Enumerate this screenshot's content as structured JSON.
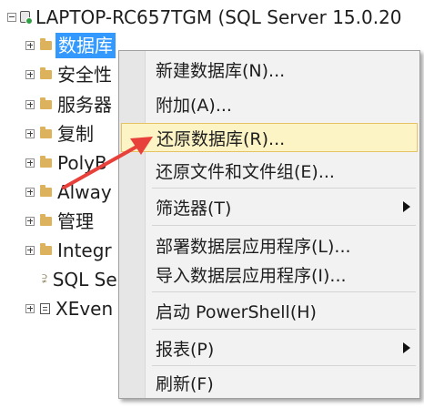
{
  "tree": {
    "server_label": "LAPTOP-RC657TGM (SQL Server 15.0.20",
    "items": [
      {
        "label": "数据库"
      },
      {
        "label": "安全性"
      },
      {
        "label": "服务器"
      },
      {
        "label": "复制"
      },
      {
        "label": "PolyB"
      },
      {
        "label": "Alway"
      },
      {
        "label": "管理"
      },
      {
        "label": "Integr"
      },
      {
        "label": "SQL Se"
      },
      {
        "label": "XEven"
      }
    ]
  },
  "context_menu": {
    "items": [
      {
        "label": "新建数据库(N)..."
      },
      {
        "label": "附加(A)..."
      },
      {
        "label": "还原数据库(R)..."
      },
      {
        "label": "还原文件和文件组(E)..."
      },
      {
        "label": "筛选器(T)"
      },
      {
        "label": "部署数据层应用程序(L)..."
      },
      {
        "label": "导入数据层应用程序(I)..."
      },
      {
        "label": "启动 PowerShell(H)"
      },
      {
        "label": "报表(P)"
      },
      {
        "label": "刷新(F)"
      }
    ],
    "highlighted": "还原数据库(R)..."
  },
  "colors": {
    "selection": "#3399ff",
    "menu_highlight": "#fcf4c5",
    "arrow": "#e8403a"
  }
}
